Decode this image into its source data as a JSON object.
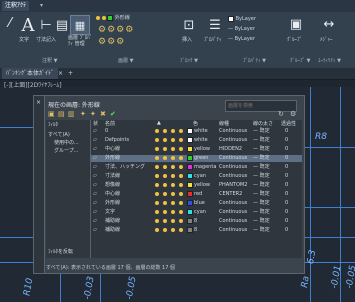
{
  "quick_access": {
    "title": "注釈ｱｸﾃ"
  },
  "ribbon": {
    "text_label": "文字",
    "dim_label": "寸法記入",
    "layer_props_label": "画層 ﾌﾟﾛﾊﾟﾃｨ 管理",
    "annot_panel": "注釈 ▼",
    "layer_panel": "画層 ▼",
    "block_panel": "ﾌﾞﾛｯｸ ▼",
    "props_panel": "ﾌﾟﾛﾊﾟﾃｨ ▼",
    "group_panel": "ｸﾞﾙｰﾌﾟ ▼",
    "util_panel": "ﾕｰﾃｨﾘﾃｨ ▼",
    "current_layer": "外形線",
    "bylayer_1": "ByLayer",
    "bylayer_2": "ByLayer",
    "bylayer_3": "ByLayer",
    "measure_label": "ﾒｼﾞｬｰ",
    "insert_label": "挿入",
    "props_label": "ﾌﾟﾛﾊﾟﾃｨ",
    "match_label": "ｺﾋﾟｰ",
    "group_label": "ｸﾞﾙｰﾌﾟ"
  },
  "doc_tabs": {
    "tab1": "ﾊﾞﾝｷﾝｸﾞ本体ｶﾞｲﾄﾞ",
    "close": "×",
    "add": "+"
  },
  "viewport_label": "[-][上面][2Dﾜｲﾔﾌﾚｰﾑ]",
  "layer_manager": {
    "title": "現在の画層: 外形線",
    "search_placeholder": "画層を検索",
    "filters_header": "ﾌｨﾙﾀ",
    "filters": [
      "すべて(A)",
      "使用中の...",
      "グループ..."
    ],
    "headers": {
      "status": "状",
      "name": "名前",
      "on": "▲",
      "color": "色",
      "linetype": "線種",
      "lineweight": "線の太さ",
      "transparency": "透過性"
    },
    "rows": [
      {
        "name": "0",
        "color": "white",
        "linetype": "Continuous",
        "lineweight": "既定",
        "transparency": "0",
        "swatch": "#ffffff",
        "sel": false
      },
      {
        "name": "Defpoints",
        "color": "white",
        "linetype": "Continuous",
        "lineweight": "既定",
        "transparency": "0",
        "swatch": "#ffffff",
        "sel": false
      },
      {
        "name": "中心線",
        "color": "yellow",
        "linetype": "HIDDEN2",
        "lineweight": "既定",
        "transparency": "0",
        "swatch": "#f0e040",
        "sel": false
      },
      {
        "name": "外形線",
        "color": "green",
        "linetype": "Continuous",
        "lineweight": "既定",
        "transparency": "0",
        "swatch": "#30d030",
        "sel": true
      },
      {
        "name": "寸法、ハッチング",
        "color": "magenta",
        "linetype": "Continuous",
        "lineweight": "既定",
        "transparency": "0",
        "swatch": "#e030e0",
        "sel": false
      },
      {
        "name": "寸法線",
        "color": "cyan",
        "linetype": "Continuous",
        "lineweight": "既定",
        "transparency": "0",
        "swatch": "#30e0e0",
        "sel": false
      },
      {
        "name": "想像線",
        "color": "yellow",
        "linetype": "PHANTOM2",
        "lineweight": "既定",
        "transparency": "0",
        "swatch": "#f0e040",
        "sel": false
      },
      {
        "name": "中心線",
        "color": "red",
        "linetype": "CENTER2",
        "lineweight": "既定",
        "transparency": "0",
        "swatch": "#e03030",
        "sel": false
      },
      {
        "name": "外形線",
        "color": "blue",
        "linetype": "Continuous",
        "lineweight": "既定",
        "transparency": "0",
        "swatch": "#3050f0",
        "sel": false
      },
      {
        "name": "文字",
        "color": "cyan",
        "linetype": "Continuous",
        "lineweight": "既定",
        "transparency": "0",
        "swatch": "#30e0e0",
        "sel": false
      },
      {
        "name": "補助線",
        "color": "8",
        "linetype": "Continuous",
        "lineweight": "既定",
        "transparency": "0",
        "swatch": "#808080",
        "sel": false
      },
      {
        "name": "補助線",
        "color": "8",
        "linetype": "Continuous",
        "lineweight": "既定",
        "transparency": "0",
        "swatch": "#808080",
        "sel": false
      }
    ],
    "invert_filter": "ﾌｨﾙﾀを反転",
    "status_text": "すべて(A): 表示されている画層 17 個、画層の総数 17 個"
  },
  "canvas_dims": [
    "R10",
    "-0.03",
    "-0.05",
    "R8",
    "R8",
    "6.3",
    "-0.01",
    "-0.05",
    "Ra"
  ]
}
